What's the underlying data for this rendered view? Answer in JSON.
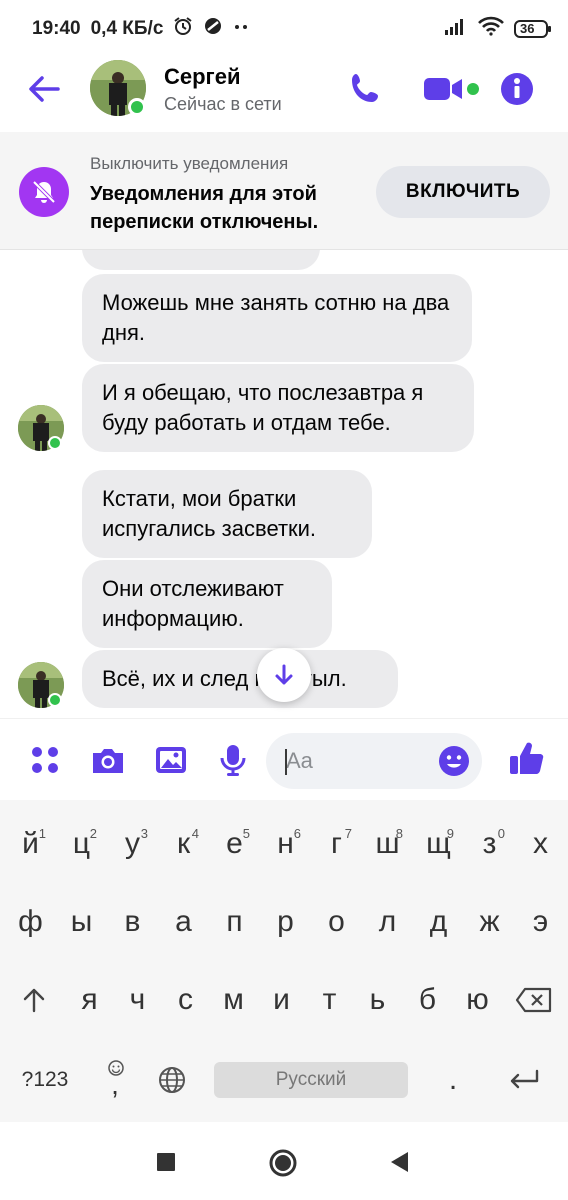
{
  "status_bar": {
    "time": "19:40",
    "speed": "0,4 КБ/с",
    "battery": "36"
  },
  "header": {
    "contact_name": "Сергей",
    "contact_status": "Сейчас в сети",
    "accent_color": "#5e3ee8",
    "online_color": "#31c24d"
  },
  "banner": {
    "small_text": "Выключить уведомления",
    "main_text": "Уведомления для этой переписки отключены.",
    "button_label": "ВКЛЮЧИТЬ",
    "icon": "bell-off-icon",
    "icon_color": "#a236f2"
  },
  "messages": [
    {
      "text": "Можешь мне занять сотню на два дня."
    },
    {
      "text": "И я обещаю, что послезавтра я буду работать и отдам тебе."
    },
    {
      "text": "Кстати, мои братки испугались засветки."
    },
    {
      "text": "Они отслеживают информацию."
    },
    {
      "text": "Всё, их и след простыл."
    }
  ],
  "composer": {
    "placeholder": "Aa"
  },
  "keyboard": {
    "row1": [
      "й",
      "ц",
      "у",
      "к",
      "е",
      "н",
      "г",
      "ш",
      "щ",
      "з",
      "х"
    ],
    "row1_numbers": [
      "1",
      "2",
      "3",
      "4",
      "5",
      "6",
      "7",
      "8",
      "9",
      "0"
    ],
    "row2": [
      "ф",
      "ы",
      "в",
      "а",
      "п",
      "р",
      "о",
      "л",
      "д",
      "ж",
      "э"
    ],
    "row3": [
      "я",
      "ч",
      "с",
      "м",
      "и",
      "т",
      "ь",
      "б",
      "ю"
    ],
    "num_key": "?123",
    "comma_key": ",",
    "space_label": "Русский",
    "period_key": "."
  }
}
